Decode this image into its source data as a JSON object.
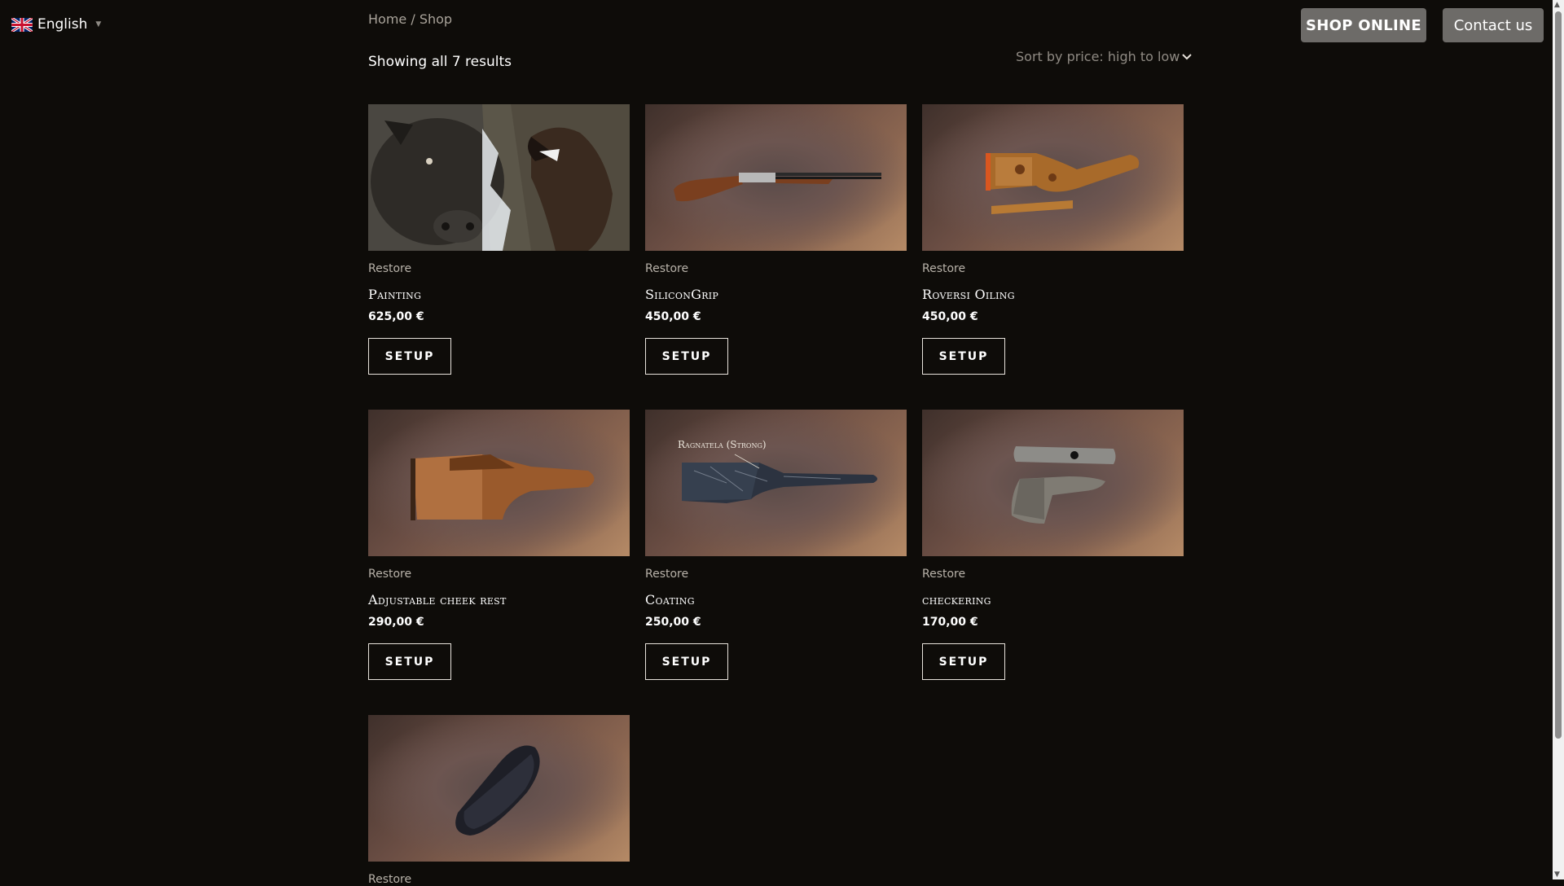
{
  "language": {
    "label": "English",
    "icon": "uk-flag-icon"
  },
  "breadcrumb": {
    "home": "Home",
    "separator": "/",
    "current": "Shop"
  },
  "header": {
    "shop_online": "SHOP ONLINE",
    "contact": "Contact us"
  },
  "results_text": "Showing all 7 results",
  "sort": {
    "selected": "Sort by price: high to low"
  },
  "products": [
    {
      "category": "Restore",
      "title": "Painting",
      "price": "625,00 €",
      "button": "SETUP",
      "image": "boar-and-dog-painting"
    },
    {
      "category": "Restore",
      "title": "SiliconGrip",
      "price": "450,00 €",
      "button": "SETUP",
      "image": "shotgun"
    },
    {
      "category": "Restore",
      "title": "Roversi Oiling",
      "price": "450,00 €",
      "button": "SETUP",
      "image": "oiled-stock"
    },
    {
      "category": "Restore",
      "title": "Adjustable cheek rest",
      "price": "290,00 €",
      "button": "SETUP",
      "image": "wooden-stock"
    },
    {
      "category": "Restore",
      "title": "Coating",
      "price": "250,00 €",
      "button": "SETUP",
      "image": "coated-stock",
      "image_label": "Ragnatela (Strong)"
    },
    {
      "category": "Restore",
      "title": "checkering",
      "price": "170,00 €",
      "button": "SETUP",
      "image": "checkered-parts"
    },
    {
      "category": "Restore",
      "title": "",
      "price": "",
      "button": "",
      "image": "recoil-pad"
    }
  ],
  "colors": {
    "background": "#0e0c09",
    "button_gray": "#6d6b68",
    "text": "#ffffff"
  }
}
